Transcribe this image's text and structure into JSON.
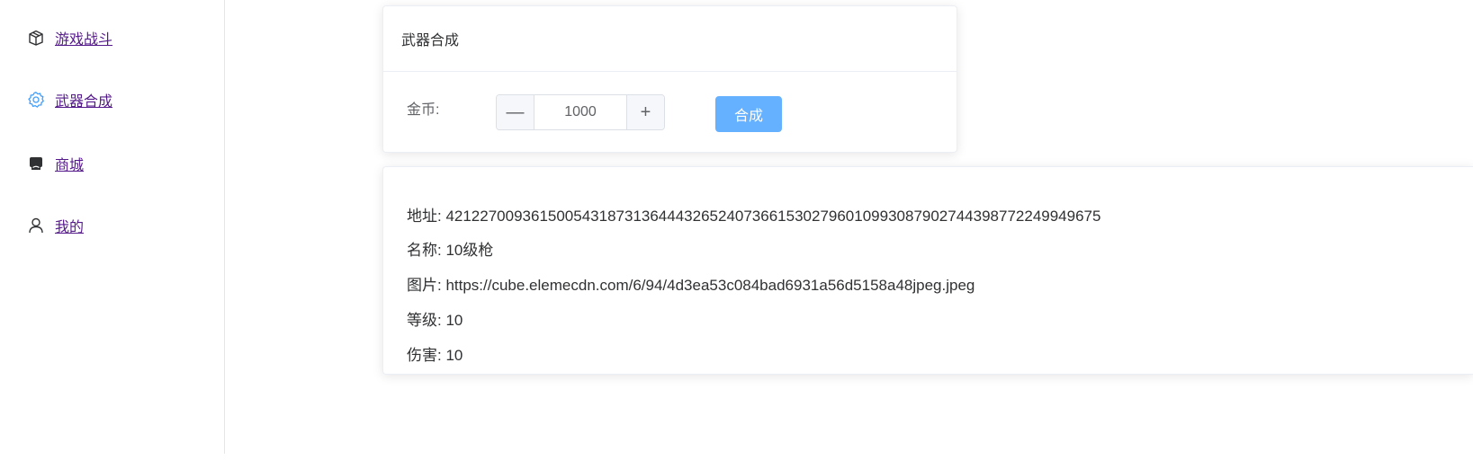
{
  "sidebar": {
    "items": [
      {
        "label": "游戏战斗",
        "icon": "box-icon"
      },
      {
        "label": "武器合成",
        "icon": "gear-icon",
        "active_color": "#409eff"
      },
      {
        "label": "商城",
        "icon": "shop-icon"
      },
      {
        "label": "我的",
        "icon": "user-icon"
      }
    ]
  },
  "forge_card": {
    "title": "武器合成",
    "coin_label": "金币:",
    "coin_value": "1000",
    "minus_symbol": "—",
    "plus_symbol": "+",
    "forge_button": "合成"
  },
  "result_card": {
    "address": "地址: 421227009361500543187313644432652407366153027960109930879027443987722499496​75",
    "name": "名称: 10级枪",
    "image": "图片: https://cube.elemecdn.com/6/94/4d3ea53c084bad6931a56d5158a48jpeg.jpeg",
    "level": "等级: 10",
    "damage": "伤害: 10"
  },
  "colors": {
    "accent": "#409eff",
    "button_bg": "#66b1ff",
    "link": "#551a8b"
  }
}
